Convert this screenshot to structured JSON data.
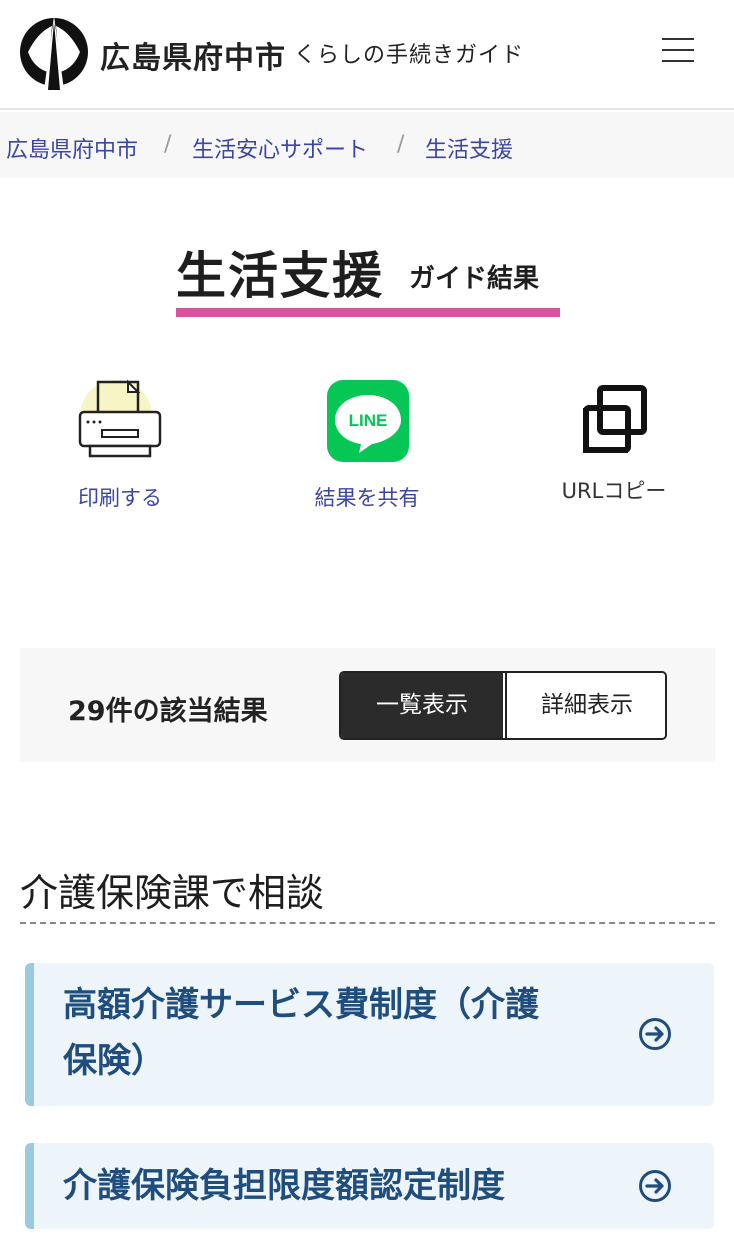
{
  "header": {
    "title": "広島県府中市",
    "subtitle": "くらしの手続きガイド"
  },
  "breadcrumb": {
    "items": [
      "広島県府中市",
      "生活安心サポート",
      "生活支援"
    ],
    "separator": "/"
  },
  "page": {
    "title": "生活支援",
    "title_suffix": "ガイド結果",
    "accent_color": "#d2569b"
  },
  "actions": {
    "print_label": "印刷する",
    "share_label": "結果を共有",
    "line_text": "LINE",
    "copy_label": "URLコピー"
  },
  "results": {
    "count_label": "29件の該当結果",
    "view_list": "一覧表示",
    "view_detail": "詳細表示"
  },
  "section": {
    "title": "介護保険課で相談",
    "cards": [
      {
        "line1": "高額介護サービス費制度（介護",
        "line2": "保険）"
      },
      {
        "line1": "介護保険負担限度額認定制度"
      }
    ]
  }
}
